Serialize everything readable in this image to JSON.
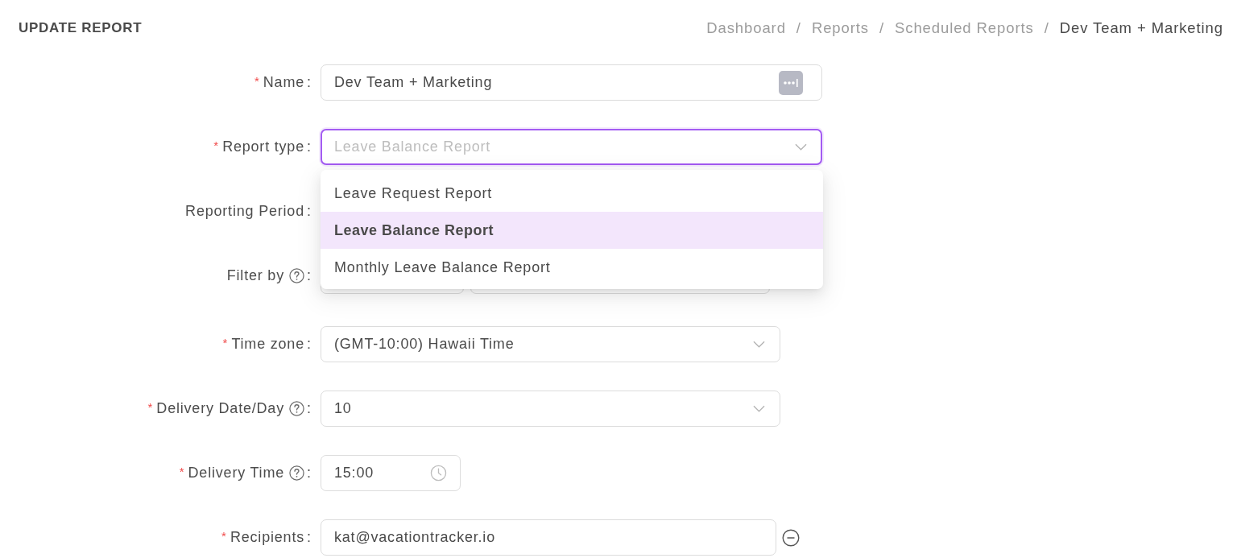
{
  "header": {
    "title": "UPDATE REPORT",
    "breadcrumb": [
      {
        "label": "Dashboard",
        "current": false,
        "separator": "/"
      },
      {
        "label": "Reports",
        "current": false,
        "separator": "/"
      },
      {
        "label": "Scheduled Reports",
        "current": false,
        "separator": "/"
      },
      {
        "label": "Dev Team + Marketing",
        "current": true
      }
    ]
  },
  "fields": [
    {
      "kind": "text",
      "required_mark": "*",
      "label": "Name",
      "help": false,
      "colon": ":",
      "value": "Dev Team + Marketing",
      "autofill_icon": true
    },
    {
      "kind": "select",
      "required_mark": "*",
      "label": "Report type",
      "help": false,
      "colon": ":",
      "value": "Leave Balance Report",
      "open": true,
      "options": [
        {
          "label": "Leave Request Report",
          "selected": false
        },
        {
          "label": "Leave Balance Report",
          "selected": true
        },
        {
          "label": "Monthly Leave Balance Report",
          "selected": false
        }
      ]
    },
    {
      "kind": "covered",
      "label": "Reporting Period",
      "help": false,
      "colon": ":"
    },
    {
      "kind": "filter",
      "label": "Filter by",
      "help": true,
      "colon": ":"
    },
    {
      "kind": "select",
      "required_mark": "*",
      "label": "Time zone",
      "help": false,
      "colon": ":",
      "value": "(GMT-10:00) Hawaii Time",
      "open": false
    },
    {
      "kind": "select",
      "required_mark": "*",
      "label": "Delivery Date/Day",
      "help": true,
      "colon": ":",
      "value": "10",
      "open": false
    },
    {
      "kind": "time",
      "required_mark": "*",
      "label": "Delivery Time",
      "help": true,
      "colon": ":",
      "value": "15:00"
    },
    {
      "kind": "email",
      "required_mark": "*",
      "label": "Recipients",
      "help": false,
      "colon": ":",
      "value": "kat@vacationtracker.io",
      "removable": true
    }
  ]
}
